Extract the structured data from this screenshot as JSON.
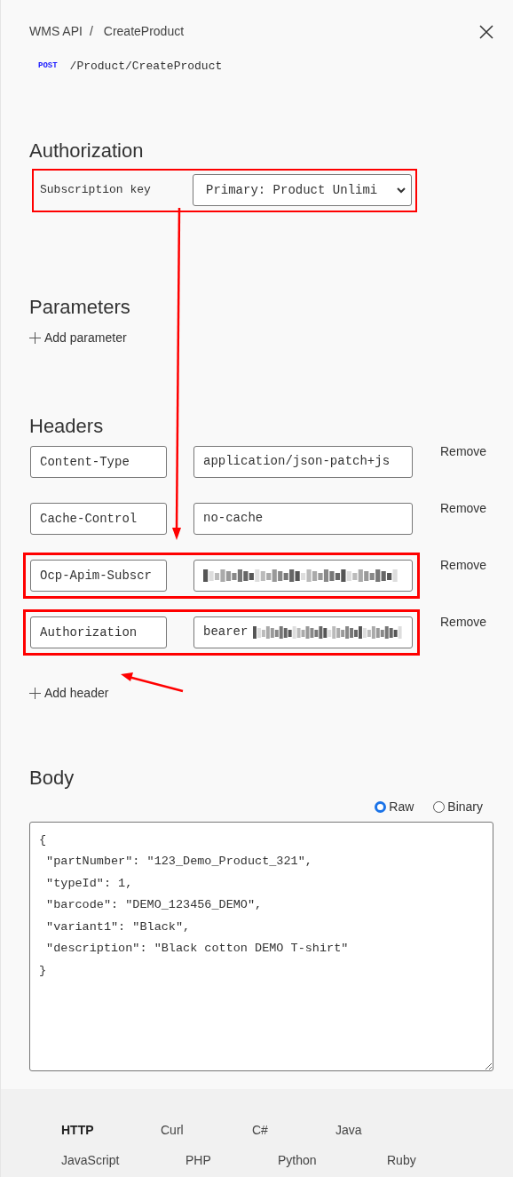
{
  "breadcrumb": {
    "api": "WMS API",
    "separator": "/",
    "operation": "CreateProduct"
  },
  "request": {
    "method": "POST",
    "path": "/Product/CreateProduct"
  },
  "authorization": {
    "title": "Authorization",
    "label": "Subscription key",
    "value": "Primary: Product Unlimi",
    "highlighted": true
  },
  "parameters": {
    "title": "Parameters",
    "add_label": "Add parameter"
  },
  "headers": {
    "title": "Headers",
    "add_label": "Add header",
    "rows": [
      {
        "name": "Content-Type",
        "value": "application/json-patch+js",
        "redacted": false,
        "highlighted": false,
        "remove_label": "Remove"
      },
      {
        "name": "Cache-Control",
        "value": "no-cache",
        "redacted": false,
        "highlighted": false,
        "remove_label": "Remove"
      },
      {
        "name": "Ocp-Apim-Subscr",
        "redacted": true,
        "highlighted": true,
        "remove_label": "Remove"
      },
      {
        "name": "Authorization",
        "value": "bearer",
        "redacted": true,
        "highlighted": true,
        "remove_label": "Remove"
      }
    ]
  },
  "body": {
    "title": "Body",
    "formats": [
      {
        "label": "Raw",
        "selected": true
      },
      {
        "label": "Binary",
        "selected": false
      }
    ],
    "lines": [
      "{",
      " \"partNumber\": \"123_Demo_Product_321\",",
      " \"typeId\": 1,",
      " \"barcode\": \"DEMO_123456_DEMO\",",
      " \"variant1\": \"Black\",",
      " \"description\": \"Black cotton DEMO T-shirt\"",
      "}"
    ]
  },
  "languages": [
    [
      {
        "label": "HTTP",
        "selected": true
      },
      {
        "label": "Curl",
        "selected": false
      },
      {
        "label": "C#",
        "selected": false
      },
      {
        "label": "Java",
        "selected": false
      }
    ],
    [
      {
        "label": "JavaScript",
        "selected": false
      },
      {
        "label": "PHP",
        "selected": false
      },
      {
        "label": "Python",
        "selected": false
      },
      {
        "label": "Ruby",
        "selected": false
      }
    ]
  ]
}
